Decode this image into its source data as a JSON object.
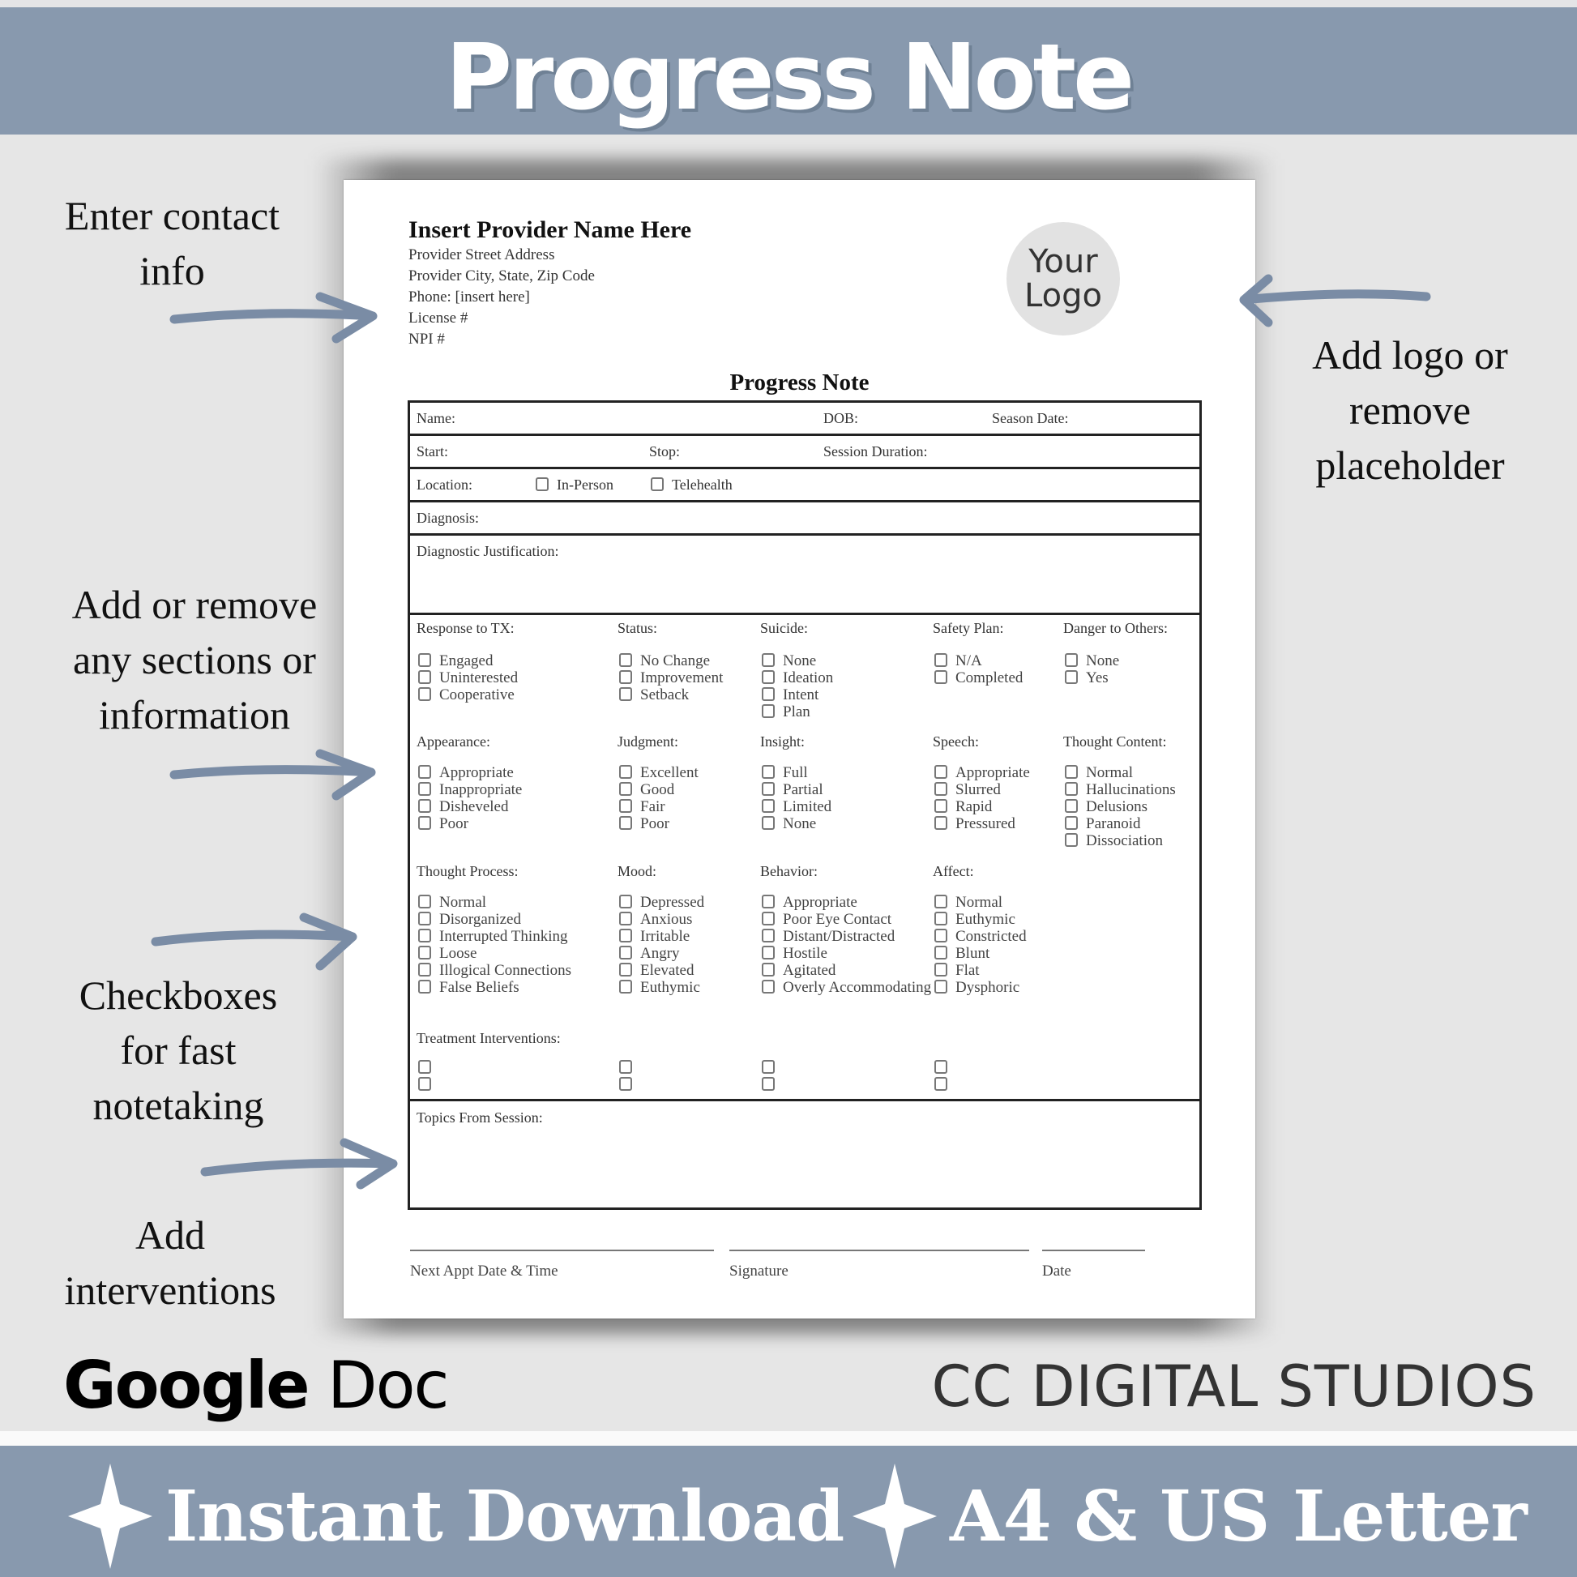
{
  "header": {
    "title": "Progress Note"
  },
  "annotations": {
    "contact": [
      "Enter contact",
      "info"
    ],
    "logo": [
      "Add logo or",
      "remove",
      "placeholder"
    ],
    "sections": [
      "Add or remove",
      "any sections or",
      "information"
    ],
    "checkboxes": [
      "Checkboxes",
      "for fast",
      "notetaking"
    ],
    "interventions": [
      "Add",
      "interventions"
    ]
  },
  "document": {
    "provider": {
      "name": "Insert Provider Name Here",
      "lines": [
        "Provider Street Address",
        "Provider City, State, Zip Code",
        "Phone: [insert here]",
        "License #",
        "NPI #"
      ]
    },
    "logo_placeholder": [
      "Your",
      "Logo"
    ],
    "title": "Progress Note",
    "fields": {
      "name": "Name:",
      "dob": "DOB:",
      "session_date": "Season Date:",
      "start": "Start:",
      "stop": "Stop:",
      "session_duration": "Session Duration:",
      "location": "Location:",
      "location_options": [
        "In-Person",
        "Telehealth"
      ],
      "diagnosis": "Diagnosis:",
      "diagnostic_justification": "Diagnostic Justification:"
    },
    "groups_row1": [
      {
        "label": "Response to TX:",
        "options": [
          "Engaged",
          "Uninterested",
          "Cooperative"
        ]
      },
      {
        "label": "Status:",
        "options": [
          "No Change",
          "Improvement",
          "Setback"
        ]
      },
      {
        "label": "Suicide:",
        "options": [
          "None",
          "Ideation",
          "Intent",
          "Plan"
        ]
      },
      {
        "label": "Safety Plan:",
        "options": [
          "N/A",
          "Completed"
        ]
      },
      {
        "label": "Danger to Others:",
        "options": [
          "None",
          "Yes"
        ]
      }
    ],
    "groups_row2": [
      {
        "label": "Appearance:",
        "options": [
          "Appropriate",
          "Inappropriate",
          "Disheveled",
          "Poor"
        ]
      },
      {
        "label": "Judgment:",
        "options": [
          "Excellent",
          "Good",
          "Fair",
          "Poor"
        ]
      },
      {
        "label": "Insight:",
        "options": [
          "Full",
          "Partial",
          "Limited",
          "None"
        ]
      },
      {
        "label": "Speech:",
        "options": [
          "Appropriate",
          "Slurred",
          "Rapid",
          "Pressured"
        ]
      },
      {
        "label": "Thought Content:",
        "options": [
          "Normal",
          "Hallucinations",
          "Delusions",
          "Paranoid",
          "Dissociation"
        ]
      }
    ],
    "groups_row3": [
      {
        "label": "Thought Process:",
        "options": [
          "Normal",
          "Disorganized",
          "Interrupted Thinking",
          "Loose",
          "Illogical Connections",
          "False Beliefs"
        ]
      },
      {
        "label": "Mood:",
        "options": [
          "Depressed",
          "Anxious",
          "Irritable",
          "Angry",
          "Elevated",
          "Euthymic"
        ]
      },
      {
        "label": "Behavior:",
        "options": [
          "Appropriate",
          "Poor Eye Contact",
          "Distant/Distracted",
          "Hostile",
          "Agitated",
          "Overly Accommodating"
        ]
      },
      {
        "label": "Affect:",
        "options": [
          "Normal",
          "Euthymic",
          "Constricted",
          "Blunt",
          "Flat",
          "Dysphoric"
        ]
      }
    ],
    "treatment_interventions": "Treatment Interventions:",
    "topics_from_session": "Topics From Session:",
    "signature_lines": [
      "Next Appt Date & Time",
      "Signature",
      "Date"
    ]
  },
  "footer": {
    "format_bold": "Google",
    "format_rest": " Doc",
    "brand": "CC DIGITAL STUDIOS",
    "features": [
      "Instant Download",
      "A4 & US Letter"
    ]
  },
  "colors": {
    "banner": "#8899ae",
    "arrow": "#7a8ca5",
    "background": "#e6e6e6"
  }
}
